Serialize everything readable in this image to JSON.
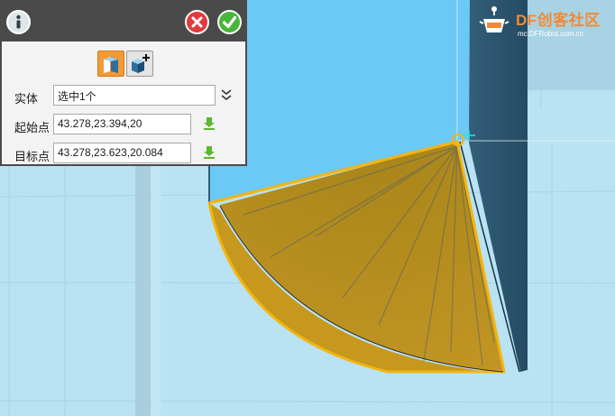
{
  "dialog": {
    "rows": [
      {
        "label": "实体",
        "value": "选中1个"
      },
      {
        "label": "起始点",
        "value": "43.278,23.394,20"
      },
      {
        "label": "目标点",
        "value": "43.278,23.623,20.084"
      }
    ]
  },
  "watermark": {
    "brand": "DF创客社区",
    "url": "mc.DFRobot.com.cn"
  },
  "colors": {
    "background": "#b9e3f3",
    "wall": "#6cc8f5",
    "dark_wall": "#2f5d78",
    "selection": "#f5b40e",
    "face": "#b98e1c",
    "panel_header": "#4a4a4a",
    "accent": "#f29a38"
  },
  "icons": [
    "info-icon",
    "close-icon",
    "confirm-icon",
    "move-mode-icon",
    "add-body-mode-icon",
    "dropdown-chevron-icon",
    "pick-point-icon"
  ]
}
